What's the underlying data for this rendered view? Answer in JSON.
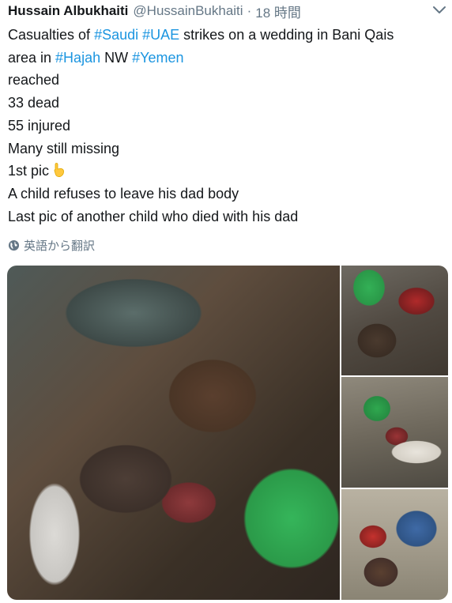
{
  "tweet": {
    "author_name": "Hussain Albukhaiti",
    "author_handle": "@HussainBukhaiti",
    "separator": "·",
    "timestamp": "18 時間",
    "line1": {
      "t1": "Casualties of ",
      "h1": "#Saudi",
      "t2": " ",
      "h2": "#UAE",
      "t3": " strikes on a wedding in Bani Qais"
    },
    "line2": {
      "t1": "area in ",
      "h1": "#Hajah",
      "t2": " NW ",
      "h2": "#Yemen"
    },
    "line3": "reached",
    "line4": "33 dead",
    "line5": "55 injured",
    "line6": "Many still missing",
    "line7": "1st pic",
    "line8": "A child refuses to leave his dad body",
    "line9": "Last pic of another child who died with his dad",
    "translate_label": "英語から翻訳"
  },
  "icons": {
    "menu": "chevron-down-icon",
    "translate": "globe-icon",
    "emoji": "pointing-down-emoji"
  },
  "colors": {
    "hashtag": "#1b95e0",
    "secondary_text": "#657786",
    "primary_text": "#14171a"
  },
  "media": {
    "photo_count": 4
  }
}
